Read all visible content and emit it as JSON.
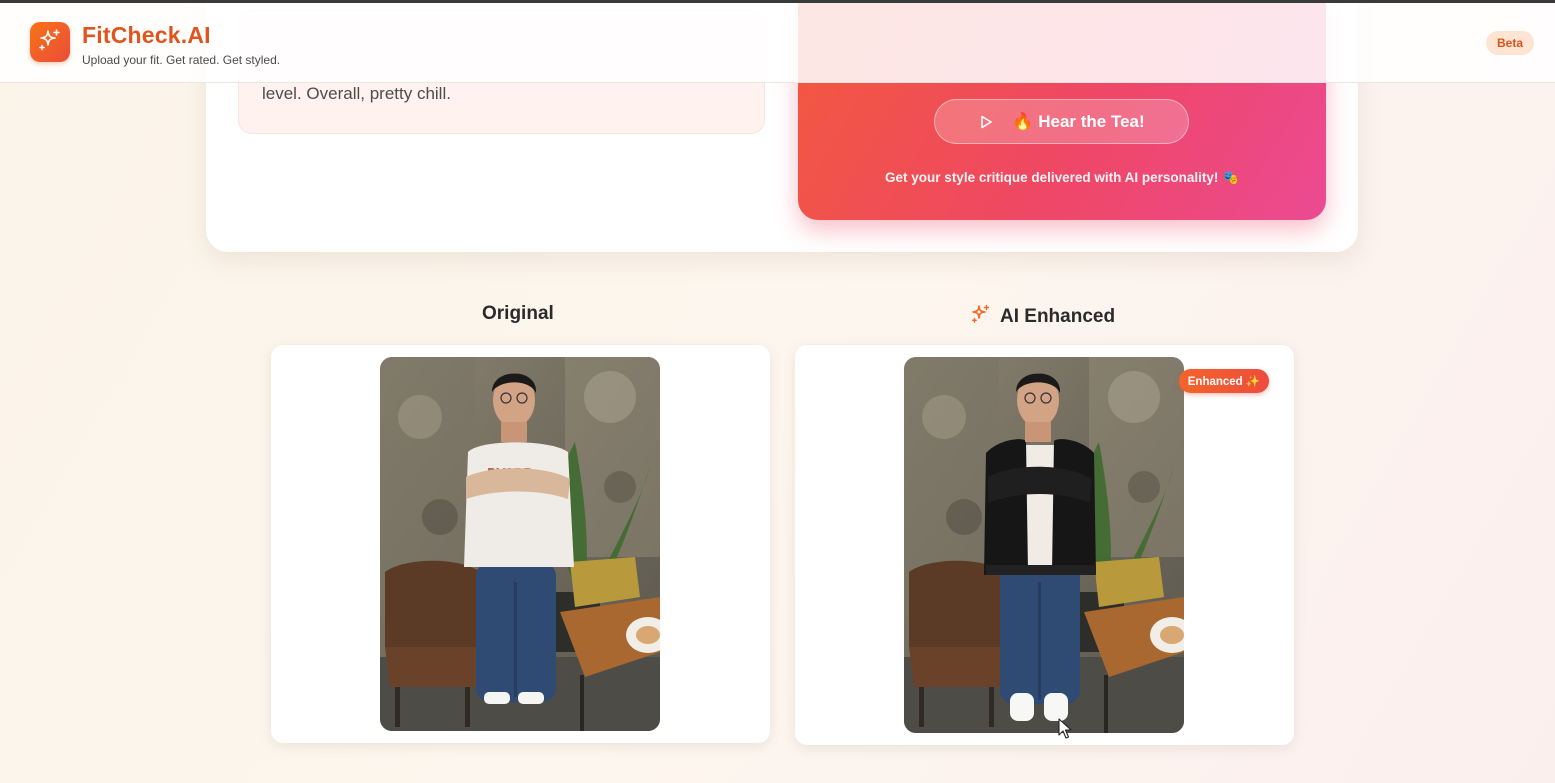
{
  "app": {
    "name": "FitCheck.AI",
    "tagline": "Upload your fit. Get rated. Get styled.",
    "badge": "Beta"
  },
  "critique": {
    "text_visible": "level. Overall, pretty chill."
  },
  "tea": {
    "button_label": "🔥 Hear the Tea!",
    "caption": "Get your style critique delivered with AI personality! 🎭"
  },
  "comparison": {
    "original_title": "Original",
    "enhanced_title": "AI Enhanced",
    "enhanced_badge": "Enhanced ✨",
    "original_photo_alt": "Person in white graphic t-shirt and jeans, arms crossed, standing in front of a stone wall with a plant and table",
    "enhanced_photo_alt": "Same person wearing a black bomber jacket over a white t-shirt and jeans"
  },
  "colors": {
    "brand": "#e0541f",
    "accent_gradient_start": "#f25a3b",
    "accent_gradient_end": "#eb4a93",
    "badge_bg": "#fde4d3"
  },
  "icons": {
    "logo": "sparkles-icon",
    "play": "play-icon",
    "enhanced": "sparkles-icon"
  }
}
